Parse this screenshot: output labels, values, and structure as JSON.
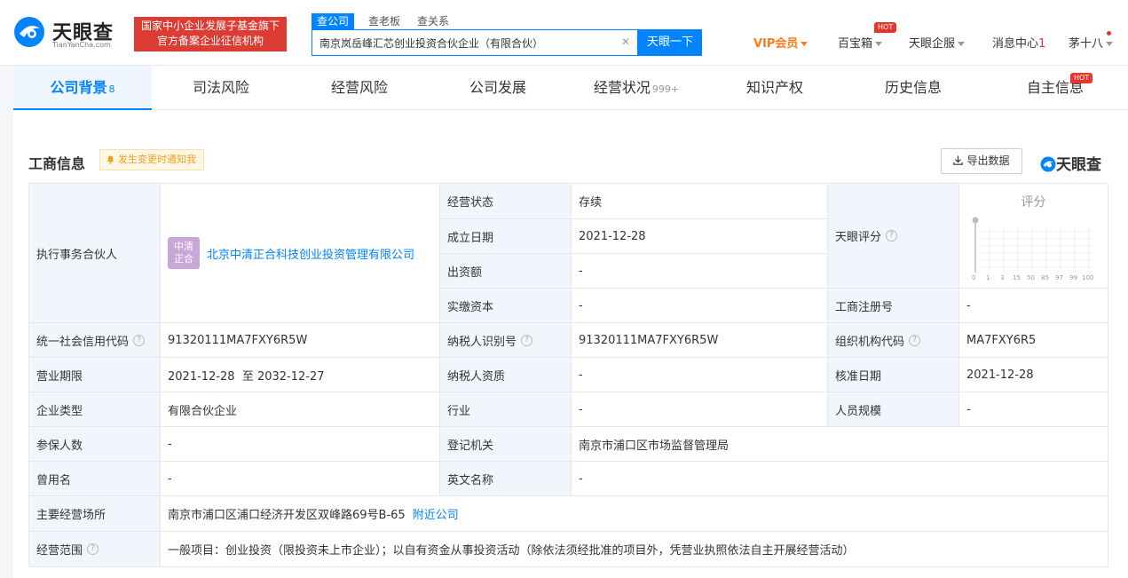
{
  "header": {
    "logo_cn": "天眼查",
    "logo_en": "TianYanCha.com",
    "gov_badge_line1": "国家中小企业发展子基金旗下",
    "gov_badge_line2": "官方备案企业征信机构",
    "search_tabs": [
      "查公司",
      "查老板",
      "查关系"
    ],
    "search_value": "南京岚岳峰汇芯创业投资合伙企业（有限合伙）",
    "search_button": "天眼一下",
    "vip": "VIP会员",
    "toolbox": "百宝箱",
    "hot": "HOT",
    "enterprise": "天眼企服",
    "messages": "消息中心",
    "message_count": "1",
    "user": "茅十八"
  },
  "tabs": [
    {
      "label": "公司背景",
      "count": "8"
    },
    {
      "label": "司法风险",
      "count": ""
    },
    {
      "label": "经营风险",
      "count": ""
    },
    {
      "label": "公司发展",
      "count": ""
    },
    {
      "label": "经营状况",
      "count": "999+"
    },
    {
      "label": "知识产权",
      "count": ""
    },
    {
      "label": "历史信息",
      "count": ""
    },
    {
      "label": "自主信息",
      "count": ""
    }
  ],
  "section": {
    "title": "工商信息",
    "notify": "发生变更时通知我",
    "export": "导出数据",
    "watermark": "天眼查"
  },
  "info": {
    "partner_label": "执行事务合伙人",
    "partner_avatar": "中清正合",
    "partner_name": "北京中清正合科技创业投资管理有限公司",
    "status_label": "经营状态",
    "status_value": "存续",
    "founded_label": "成立日期",
    "founded_value": "2021-12-28",
    "capital_label": "出资额",
    "capital_value": "-",
    "paid_label": "实缴资本",
    "paid_value": "-",
    "score_label": "天眼评分",
    "score_title": "评分",
    "score_ticks": [
      "0",
      "1",
      "3",
      "15",
      "50",
      "85",
      "97",
      "99",
      "100"
    ],
    "reg_no_label": "工商注册号",
    "reg_no_value": "-",
    "credit_label": "统一社会信用代码",
    "credit_value": "91320111MA7FXY6R5W",
    "taxid_label": "纳税人识别号",
    "taxid_value": "91320111MA7FXY6R5W",
    "org_label": "组织机构代码",
    "org_value": "MA7FXY6R5",
    "term_label": "营业期限",
    "term_value": "2021-12-28  至 2032-12-27",
    "taxq_label": "纳税人资质",
    "taxq_value": "-",
    "approve_label": "核准日期",
    "approve_value": "2021-12-28",
    "type_label": "企业类型",
    "type_value": "有限合伙企业",
    "industry_label": "行业",
    "industry_value": "-",
    "staff_label": "人员规模",
    "staff_value": "-",
    "insured_label": "参保人数",
    "insured_value": "-",
    "authority_label": "登记机关",
    "authority_value": "南京市浦口区市场监督管理局",
    "former_label": "曾用名",
    "former_value": "-",
    "english_label": "英文名称",
    "english_value": "-",
    "address_label": "主要经营场所",
    "address_value": "南京市浦口区浦口经济开发区双峰路69号B-65",
    "nearby": "附近公司",
    "scope_label": "经营范围",
    "scope_value": "一般项目：创业投资（限投资未上市企业）；以自有资金从事投资活动（除依法须经批准的项目外，凭营业执照依法自主开展经营活动）"
  },
  "colors": {
    "accent": "#0084ff",
    "hot": "#e6352b",
    "vip": "#ff7a1a",
    "label_bg": "#f2f6fc",
    "badge_bg": "#dc3c33"
  }
}
